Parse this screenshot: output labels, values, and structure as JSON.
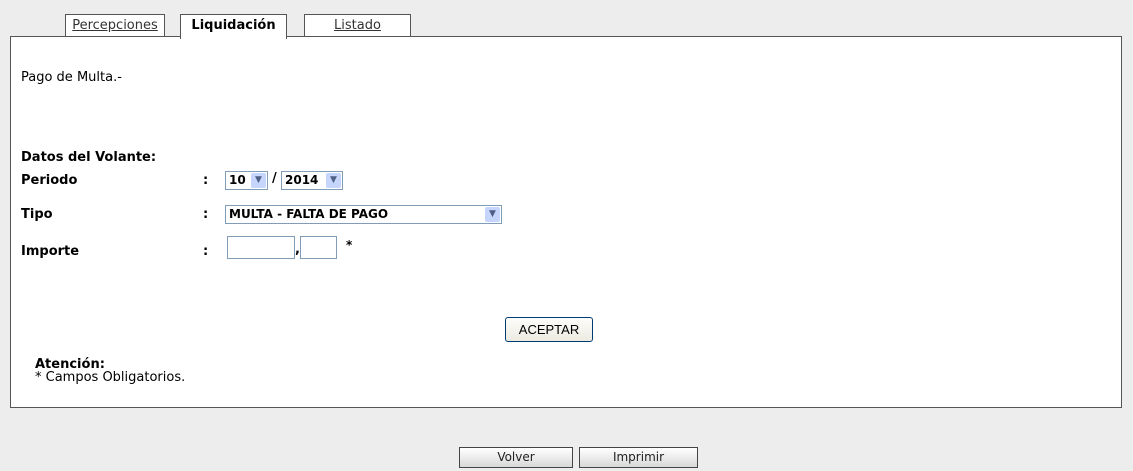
{
  "tabs": [
    {
      "label": "Percepciones"
    },
    {
      "label": "Liquidación"
    },
    {
      "label": "Listado"
    }
  ],
  "panel": {
    "title": "Pago de Multa.-",
    "section_title": "Datos del Volante:",
    "periodo": {
      "label": "Periodo",
      "colon": ":",
      "month": "10",
      "separator": "/",
      "year": "2014"
    },
    "tipo": {
      "label": "Tipo",
      "colon": ":",
      "value": "MULTA - FALTA DE PAGO"
    },
    "importe": {
      "label": "Importe",
      "colon": ":",
      "integer": "",
      "comma": ",",
      "decimal": "",
      "required_mark": "*"
    },
    "accept_label": "ACEPTAR",
    "note": {
      "title": "Atención:",
      "text": "* Campos Obligatorios."
    }
  },
  "footer": {
    "back_label": "Volver",
    "print_label": "Imprimir"
  }
}
